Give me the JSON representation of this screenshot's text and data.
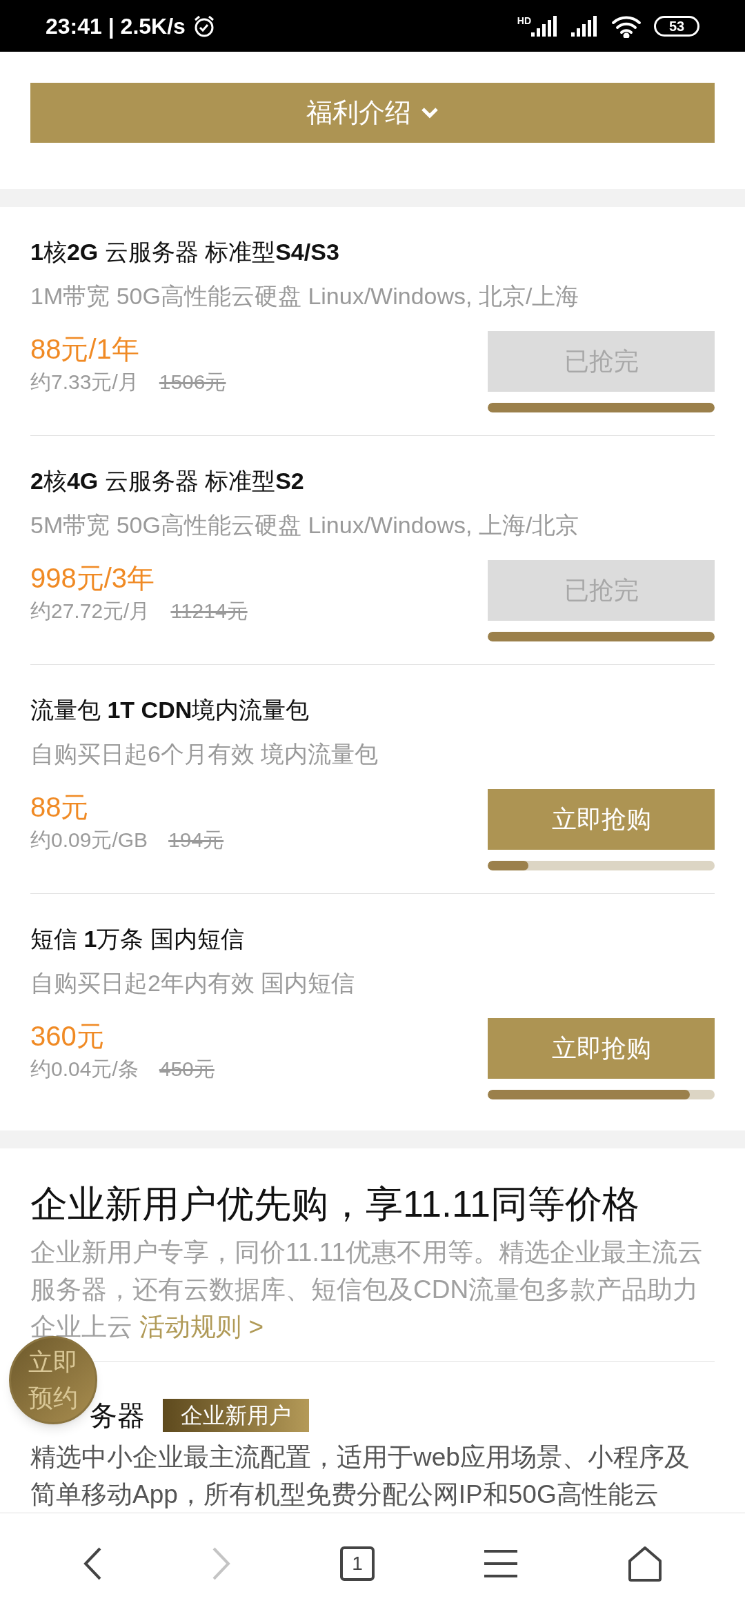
{
  "status_bar": {
    "time": "23:41 | 2.5K/s",
    "network_badge": "HD",
    "battery": "53"
  },
  "benefits_button": {
    "label": "福利介绍",
    "expanded": false
  },
  "products": [
    {
      "title": "**1**核**2G** 云服务器 标准型**S4/S3**",
      "desc": "1M带宽 50G高性能云硬盘 Linux/Windows, 北京/上海",
      "price": "88元/1年",
      "unit_price": "约7.33元/月",
      "original_price": "1506元",
      "button": "已抢完",
      "sold_out": true,
      "level": 1
    },
    {
      "title": "**2**核**4G** 云服务器 标准型**S2**",
      "desc": "5M带宽 50G高性能云硬盘 Linux/Windows, 上海/北京",
      "price": "998元/3年",
      "unit_price": "约27.72元/月",
      "original_price": "11214元",
      "button": "已抢完",
      "sold_out": true,
      "level": 1
    },
    {
      "title": "流量包 **1T CDN**境内流量包",
      "desc": "自购买日起6个月有效 境内流量包",
      "price": "88元",
      "unit_price": "约0.09元/GB",
      "original_price": "194元",
      "button": "立即抢购",
      "sold_out": false,
      "level": 0.18
    },
    {
      "title": "短信 **1**万条 国内短信",
      "desc": "自购买日起2年内有效 国内短信",
      "price": "360元",
      "unit_price": "约0.04元/条",
      "original_price": "450元",
      "button": "立即抢购",
      "sold_out": false,
      "level": 0.89
    }
  ],
  "enterprise": {
    "heading": "企业新用户优先购，享11.11同等价格",
    "desc": "企业新用户专享，同价11.11优惠不用等。精选企业最主流云服务器，还有云数据库、短信包及CDN流量包多款产品助力企业上云",
    "rules_link": "活动规则 >",
    "sub_heading": "务器",
    "tag": "企业新用户",
    "body": "精选中小企业最主流配置，适用于web应用场景、小程序及简单移动App，所有机型免费分配公网IP和50G高性能云"
  },
  "floating_button": {
    "label": "立即预约"
  },
  "bottom_nav": {
    "tab_count": "1",
    "forward_disabled": true
  }
}
